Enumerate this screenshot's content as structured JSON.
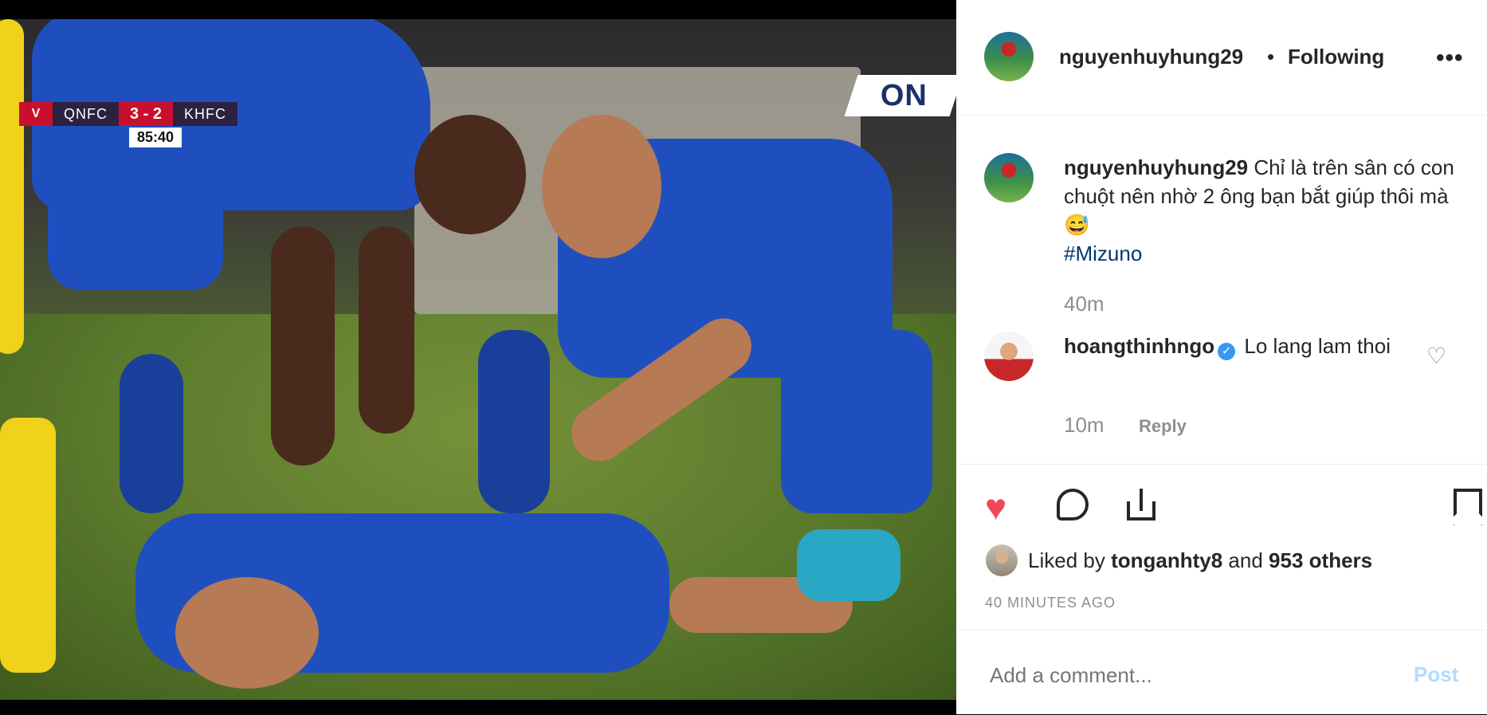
{
  "scorebug": {
    "home": "QNFC",
    "score": "3 - 2",
    "away": "KHFC",
    "clock": "85:40"
  },
  "broadcaster": "ON",
  "header": {
    "username": "nguyenhuyhung29",
    "separator": "•",
    "follow_status": "Following",
    "more": "•••"
  },
  "caption": {
    "username": "nguyenhuyhung29",
    "text": "Chỉ là trên sân có con chuột nên nhờ 2 ông bạn bắt giúp thôi mà 😅",
    "hashtag": "#Mizuno",
    "time": "40m"
  },
  "comment": {
    "username": "hoangthinhngo",
    "verified_icon": "✓",
    "text": "Lo lang lam thoi",
    "time": "10m",
    "reply_label": "Reply"
  },
  "likes": {
    "prefix": "Liked by",
    "user": "tonganhty8",
    "and": "and",
    "others": "953 others"
  },
  "timestamp": "40 MINUTES AGO",
  "add_comment": {
    "placeholder": "Add a comment...",
    "post_label": "Post"
  },
  "icons": {
    "like": "heart-icon",
    "comment": "comment-icon",
    "share": "share-icon",
    "save": "bookmark-icon"
  },
  "colors": {
    "like_red": "#ed4956",
    "hashtag_blue": "#00376b",
    "verified_blue": "#3897f0",
    "post_disabled": "#b3dbff"
  }
}
